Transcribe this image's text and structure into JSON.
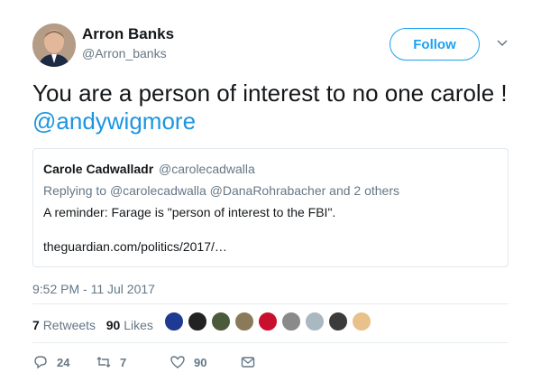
{
  "author": {
    "name": "Arron Banks",
    "handle": "@Arron_banks",
    "follow_label": "Follow"
  },
  "tweet": {
    "text": "You are a person of interest to no one carole ! ",
    "mention": "@andywigmore",
    "timestamp": "9:52 PM - 11 Jul 2017"
  },
  "quoted": {
    "name": "Carole Cadwalladr",
    "handle": "@carolecadwalla",
    "reply_prefix": "Replying to",
    "reply_handles": "@carolecadwalla @DanaRohrabacher",
    "reply_suffix": "and 2 others",
    "text": "A reminder: Farage is \"person of interest to the FBI\".",
    "link": "theguardian.com/politics/2017/…"
  },
  "stats": {
    "retweets_count": "7",
    "retweets_label": "Retweets",
    "likes_count": "90",
    "likes_label": "Likes",
    "likers": [
      {
        "icon": "union-jack-avatar",
        "color": "#1f3a93"
      },
      {
        "icon": "dark-avatar",
        "color": "#222222"
      },
      {
        "icon": "ink-avatar",
        "color": "#4a5a3a"
      },
      {
        "icon": "photo-avatar",
        "color": "#8a7a5a"
      },
      {
        "icon": "union-jack-avatar",
        "color": "#c8102e"
      },
      {
        "icon": "grey-avatar",
        "color": "#8a8a8a"
      },
      {
        "icon": "default-avatar",
        "color": "#aab8c2"
      },
      {
        "icon": "person-avatar",
        "color": "#3b3b3b"
      },
      {
        "icon": "blonde-avatar",
        "color": "#e8c28a"
      }
    ]
  },
  "actions": {
    "replies": "24",
    "retweets": "7",
    "likes": "90"
  }
}
